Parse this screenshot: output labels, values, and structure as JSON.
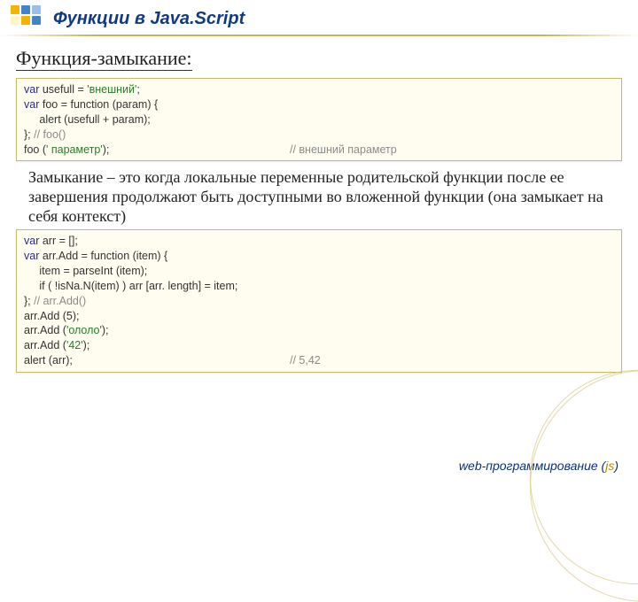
{
  "header": {
    "title": "Функции в Java.Script"
  },
  "subtitle": "Функция-замыкание:",
  "code1": {
    "l1_a": "var",
    "l1_b": " usefull = ",
    "l1_c": "'внешний'",
    "l1_d": ";",
    "l2": "",
    "l3_a": "var",
    "l3_b": " foo = function (param) {",
    "l4": "     alert (usefull + param);",
    "l5_a": "}; ",
    "l5_b": "// foo()",
    "l6": "",
    "l7_a": "foo (",
    "l7_b": "' параметр'",
    "l7_c": ");",
    "l7_cmt": "// внешний параметр"
  },
  "paragraph": "Замыкание – это когда локальные переменные родительской функции после ее завершения продолжают быть доступными во вложенной функции (она замыкает на себя контекст)",
  "code2": {
    "l1_a": "var",
    "l1_b": " arr = [];",
    "l2": "",
    "l3_a": "var",
    "l3_b": " arr.Add = function (item) {",
    "l4": "     item = parseInt (item);",
    "l5": "     if ( !isNa.N(item) ) arr [arr. length] = item;",
    "l6_a": "}; ",
    "l6_b": "// arr.Add()",
    "l7": "",
    "l8": "arr.Add (5);",
    "l9_a": "arr.Add (",
    "l9_b": "'ололо'",
    "l9_c": ");",
    "l10_a": "arr.Add (",
    "l10_b": "'42'",
    "l10_c": ");",
    "l11_a": "alert (arr);",
    "l11_cmt": "// 5,42"
  },
  "footer": {
    "text": "web-программирование",
    "paren_open": " (",
    "js": "js",
    "paren_close": ")"
  }
}
